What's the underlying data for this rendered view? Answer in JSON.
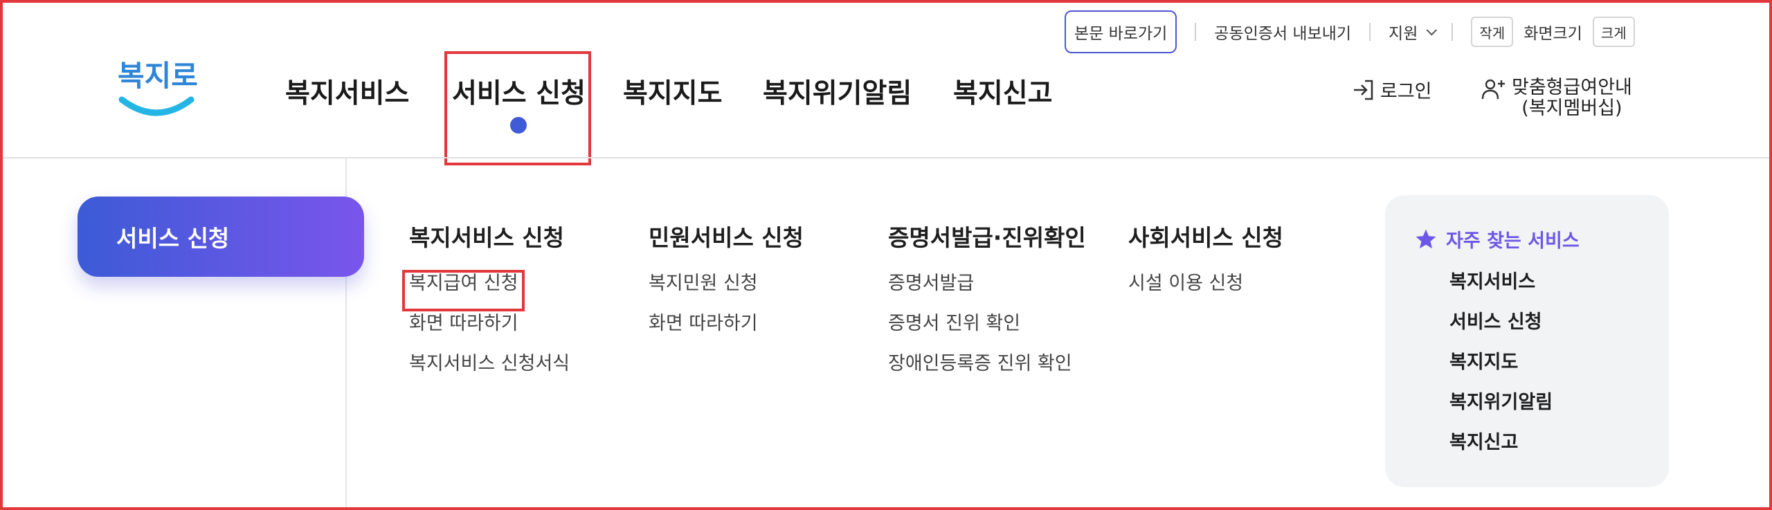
{
  "util": {
    "skip": "본문 바로가기",
    "cert": "공동인증서 내보내기",
    "support": "지원",
    "small": "작게",
    "fontsize": "화면크기",
    "large": "크게"
  },
  "logo": {
    "text": "복지로"
  },
  "gnb": [
    {
      "label": "복지서비스"
    },
    {
      "label": "서비스 신청"
    },
    {
      "label": "복지지도"
    },
    {
      "label": "복지위기알림"
    },
    {
      "label": "복지신고"
    }
  ],
  "header": {
    "login": "로그인",
    "member_line1": "맞춤형급여안내",
    "member_line2": "(복지멤버십)"
  },
  "submenu": {
    "title": "서비스 신청",
    "columns": [
      {
        "heading": "복지서비스 신청",
        "items": [
          "복지급여 신청",
          "화면 따라하기",
          "복지서비스 신청서식"
        ]
      },
      {
        "heading": "민원서비스 신청",
        "items": [
          "복지민원 신청",
          "화면 따라하기"
        ]
      },
      {
        "heading": "증명서발급·진위확인",
        "items": [
          "증명서발급",
          "증명서 진위 확인",
          "장애인등록증 진위 확인"
        ]
      },
      {
        "heading": "사회서비스 신청",
        "items": [
          "시설 이용 신청"
        ]
      }
    ]
  },
  "favorites": {
    "title": "자주 찾는 서비스",
    "items": [
      "복지서비스",
      "서비스 신청",
      "복지지도",
      "복지위기알림",
      "복지신고"
    ]
  },
  "colors": {
    "accent_blue": "#3f5bd8",
    "accent_purple": "#6b57e6",
    "highlight_red": "#e0383b",
    "pill_gradient_start": "#3c5bd6",
    "pill_gradient_end": "#7a55ec"
  },
  "icons": [
    "login-icon",
    "user-plus-icon",
    "star-icon",
    "chevron-down-icon"
  ]
}
